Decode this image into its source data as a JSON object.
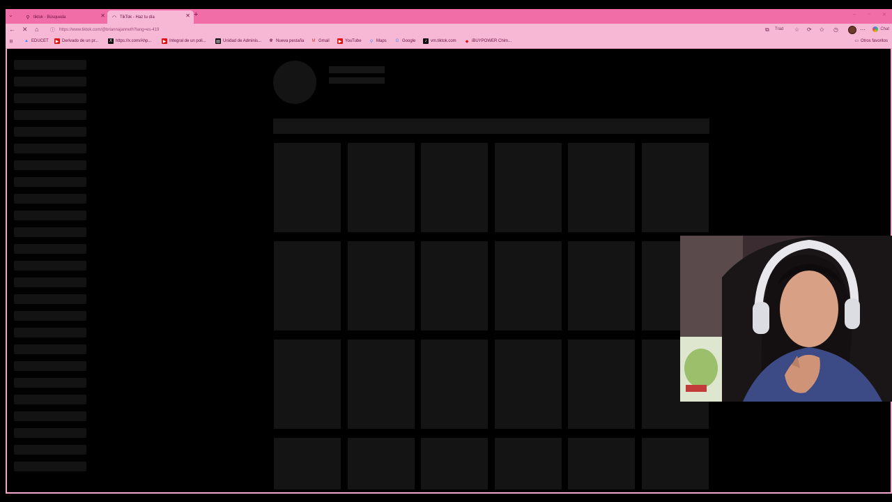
{
  "browser": {
    "tabs": [
      {
        "label": "tiktok - Búsqueda",
        "active": false
      },
      {
        "label": "TikTok - Haz tu día",
        "active": true
      }
    ],
    "url": "https://www.tiktok.com/@briannajanneth?lang=es-419",
    "translate_label": "Trad",
    "chat_label": "Chat",
    "bookmarks": [
      {
        "label": "EDUCET",
        "icon": "educet-icon"
      },
      {
        "label": "Derivado de un pr...",
        "icon": "youtube-icon"
      },
      {
        "label": "https://x.com/Ahp...",
        "icon": "x-icon"
      },
      {
        "label": "Integral de un poli...",
        "icon": "youtube-icon"
      },
      {
        "label": "Unidad de Adminis...",
        "icon": "document-icon"
      },
      {
        "label": "Nueva pestaña",
        "icon": "globe-icon"
      },
      {
        "label": "Gmail",
        "icon": "gmail-icon"
      },
      {
        "label": "YouTube",
        "icon": "youtube-icon"
      },
      {
        "label": "Maps",
        "icon": "maps-icon"
      },
      {
        "label": "Google",
        "icon": "google-icon"
      },
      {
        "label": "vm.tiktok.com",
        "icon": "tiktok-icon"
      },
      {
        "label": "iBUYPOWER Chim...",
        "icon": "ibuypower-icon"
      }
    ],
    "other_favorites": "Otros favoritos"
  },
  "colors": {
    "tabbar": "#f06da7",
    "toolbar": "#f7b8d6",
    "page_bg": "#000000",
    "skeleton": "#141414"
  },
  "page": {
    "state": "loading skeleton",
    "grid_columns": 6,
    "grid_rows": 4
  },
  "overlay": {
    "type": "webcam",
    "description": "streamer with headset"
  }
}
